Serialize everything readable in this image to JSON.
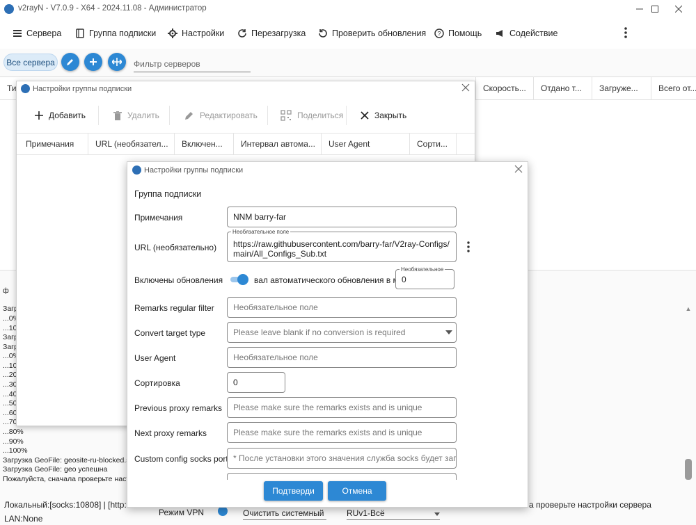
{
  "window": {
    "title": "v2rayN - V7.0.9 - X64 - 2024.11.08 - Администратор"
  },
  "toolbar": {
    "servers": "Сервера",
    "sub_group": "Группа подписки",
    "settings": "Настройки",
    "reload": "Перезагрузка",
    "check_updates": "Проверить обновления",
    "help": "Помощь",
    "promotion": "Содействие"
  },
  "filterbar": {
    "all_servers": "Все сервера",
    "filter_placeholder": "Фильтр серверов"
  },
  "grid": {
    "columns": [
      "Ти",
      "Скорость...",
      "Отдано т...",
      "Загруже...",
      "Всего от..."
    ]
  },
  "log": {
    "lines": [
      "ф",
      "Загр",
      "...0%",
      "...10",
      "Загр",
      "Загр",
      "...0%",
      "...10",
      "...20",
      "...30",
      "...40",
      "...50",
      "...60",
      "...70",
      "...80%",
      "...90%",
      "...100%",
      "Загрузка GeoFile: geosite-ru-blocked.srs",
      "Загрузка GeoFile: geo успешна",
      "Пожалуйста, сначала проверьте настр"
    ]
  },
  "statusbar": {
    "local": "Локальный:[socks:10808] | [http:108",
    "lan": "LAN:None",
    "vpn_mode": "Режим VPN",
    "proxy_combo": "Очистить системный пр",
    "routing_combo": "RUv1-Всё",
    "right_text": "а проверьте настройки сервера"
  },
  "dialog1": {
    "title": "Настройки группы подписки",
    "toolbar": {
      "add": "Добавить",
      "delete": "Удалить",
      "edit": "Редактировать",
      "share": "Поделиться",
      "close": "Закрыть"
    },
    "columns": [
      "Примечания",
      "URL (необязател...",
      "Включен...",
      "Интервал автома...",
      "User Agent",
      "Сорти..."
    ]
  },
  "dialog2": {
    "title": "Настройки группы подписки",
    "section": "Группа подписки",
    "labels": {
      "remarks": "Примечания",
      "url": "URL (необязательно)",
      "updates": "Включены обновления",
      "regex": "Remarks regular filter",
      "convert": "Convert target type",
      "user_agent": "User Agent",
      "sort": "Сортировка",
      "prev_proxy": "Previous proxy remarks",
      "next_proxy": "Next proxy remarks",
      "socks_port": "Custom config socks port"
    },
    "values": {
      "remarks": "NNM barry-far",
      "url_line1": "https://raw.githubusercontent.com/barry-far/V2ray-Configs/",
      "url_line2": "main/All_Configs_Sub.txt",
      "interval": "0",
      "sort": "0"
    },
    "float_labels": {
      "url": "Необязательное поле",
      "interval": "Необязательное"
    },
    "interval_label": "вал автоматического обновления в м",
    "placeholders": {
      "regex": "Необязательное поле",
      "convert": "Please leave blank if no conversion is required",
      "user_agent": "Необязательное поле",
      "prev_proxy": "Please make sure the remarks exists and is unique",
      "next_proxy": "Please make sure the remarks exists and is unique",
      "socks_port": "* После установки этого значения служба socks будет запущ"
    },
    "buttons": {
      "confirm": "Подтверди",
      "cancel": "Отмена"
    }
  },
  "colors": {
    "accent": "#2d88d4",
    "logo": "#2d6fb5"
  }
}
